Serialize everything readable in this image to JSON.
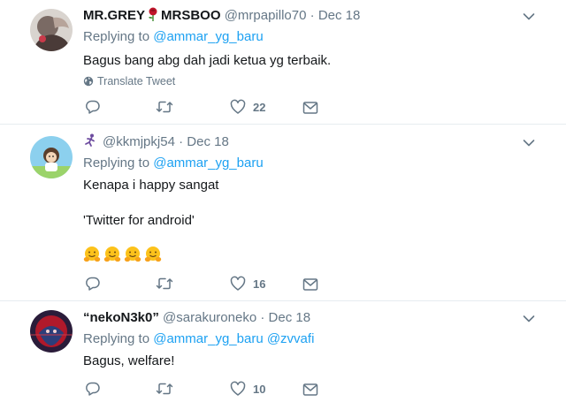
{
  "tweets": [
    {
      "name_part1": "MR.GREY",
      "name_part2": "MRSBOO",
      "handle": "@mrpapillo70",
      "separator": "·",
      "date": "Dec 18",
      "replying_prefix": "Replying to",
      "replying_to": "@ammar_yg_baru",
      "text": "Bagus bang abg dah jadi ketua yg terbaik.",
      "translate_label": "Translate Tweet",
      "likes": "22"
    },
    {
      "handle": "@kkmjpkj54",
      "separator": "·",
      "date": "Dec 18",
      "replying_prefix": "Replying to",
      "replying_to": "@ammar_yg_baru",
      "text_line1": "Kenapa i happy sangat",
      "text_line2": "'Twitter for android'",
      "likes": "16"
    },
    {
      "name": "“nekoN3k0”",
      "handle": "@sarakuroneko",
      "separator": "·",
      "date": "Dec 18",
      "replying_prefix": "Replying to",
      "replying_to": "@ammar_yg_baru @zvvafi",
      "text": "Bagus, welfare!",
      "likes": "10"
    }
  ],
  "icons": {
    "reply": "reply-icon",
    "retweet": "retweet-icon",
    "like": "heart-icon",
    "dm": "envelope-icon",
    "more": "chevron-down-icon",
    "globe": "globe-icon",
    "rose": "rose-emoji",
    "runner": "runner-emoji",
    "hug": "hugging-face-emoji"
  },
  "colors": {
    "link": "#1da1f2",
    "secondary": "#657786",
    "border": "#e6ecf0"
  }
}
